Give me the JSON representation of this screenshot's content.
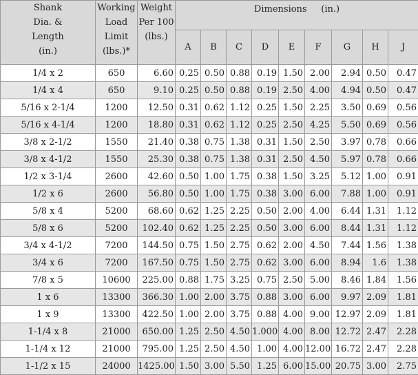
{
  "headers": {
    "shank": [
      "Shank",
      "Dia. &",
      "Length",
      "(in.)"
    ],
    "wll": [
      "Working",
      "Load",
      "Limit",
      "(lbs.)*"
    ],
    "weight": [
      "Weight",
      "Per 100",
      "(lbs.)"
    ],
    "dimensions": "Dimensions     (in.)",
    "letters": [
      "A",
      "B",
      "C",
      "D",
      "E",
      "F",
      "G",
      "H",
      "J"
    ]
  },
  "rows": [
    {
      "size": "1/4 x 2",
      "wll": "650",
      "weight": "6.60",
      "dims": [
        "0.25",
        "0.50",
        "0.88",
        "0.19",
        "1.50",
        "2.00",
        "2.94",
        "0.50",
        "0.47"
      ]
    },
    {
      "size": "1/4 x 4",
      "wll": "650",
      "weight": "9.10",
      "dims": [
        "0.25",
        "0.50",
        "0.88",
        "0.19",
        "2.50",
        "4.00",
        "4.94",
        "0.50",
        "0.47"
      ]
    },
    {
      "size": "5/16 x 2-1/4",
      "wll": "1200",
      "weight": "12.50",
      "dims": [
        "0.31",
        "0.62",
        "1.12",
        "0.25",
        "1.50",
        "2.25",
        "3.50",
        "0.69",
        "0.56"
      ]
    },
    {
      "size": "5/16 x 4-1/4",
      "wll": "1200",
      "weight": "18.80",
      "dims": [
        "0.31",
        "0.62",
        "1.12",
        "0.25",
        "2.50",
        "4.25",
        "5.50",
        "0.69",
        "0.56"
      ]
    },
    {
      "size": "3/8 x 2-1/2",
      "wll": "1550",
      "weight": "21.40",
      "dims": [
        "0.38",
        "0.75",
        "1.38",
        "0.31",
        "1.50",
        "2.50",
        "3.97",
        "0.78",
        "0.66"
      ]
    },
    {
      "size": "3/8 x 4-1/2",
      "wll": "1550",
      "weight": "25.30",
      "dims": [
        "0.38",
        "0.75",
        "1.38",
        "0.31",
        "2.50",
        "4.50",
        "5.97",
        "0.78",
        "0.66"
      ]
    },
    {
      "size": "1/2 x 3-1/4",
      "wll": "2600",
      "weight": "42.60",
      "dims": [
        "0.50",
        "1.00",
        "1.75",
        "0.38",
        "1.50",
        "3.25",
        "5.12",
        "1.00",
        "0.91"
      ]
    },
    {
      "size": "1/2 x 6",
      "wll": "2600",
      "weight": "56.80",
      "dims": [
        "0.50",
        "1.00",
        "1.75",
        "0.38",
        "3.00",
        "6.00",
        "7.88",
        "1.00",
        "0.91"
      ]
    },
    {
      "size": "5/8 x 4",
      "wll": "5200",
      "weight": "68.60",
      "dims": [
        "0.62",
        "1.25",
        "2.25",
        "0.50",
        "2.00",
        "4.00",
        "6.44",
        "1.31",
        "1.12"
      ]
    },
    {
      "size": "5/8 x 6",
      "wll": "5200",
      "weight": "102.40",
      "dims": [
        "0.62",
        "1.25",
        "2.25",
        "0.50",
        "3.00",
        "6.00",
        "8.44",
        "1.31",
        "1.12"
      ]
    },
    {
      "size": "3/4 x 4-1/2",
      "wll": "7200",
      "weight": "144.50",
      "dims": [
        "0.75",
        "1.50",
        "2.75",
        "0.62",
        "2.00",
        "4.50",
        "7.44",
        "1.56",
        "1.38"
      ]
    },
    {
      "size": "3/4 x 6",
      "wll": "7200",
      "weight": "167.50",
      "dims": [
        "0.75",
        "1.50",
        "2.75",
        "0.62",
        "3.00",
        "6.00",
        "8.94",
        "1.6",
        "1.38"
      ]
    },
    {
      "size": "7/8 x 5",
      "wll": "10600",
      "weight": "225.00",
      "dims": [
        "0.88",
        "1.75",
        "3.25",
        "0.75",
        "2.50",
        "5.00",
        "8.46",
        "1.84",
        "1.56"
      ]
    },
    {
      "size": "1 x 6",
      "wll": "13300",
      "weight": "366.30",
      "dims": [
        "1.00",
        "2.00",
        "3.75",
        "0.88",
        "3.00",
        "6.00",
        "9.97",
        "2.09",
        "1.81"
      ]
    },
    {
      "size": "1 x 9",
      "wll": "13300",
      "weight": "422.50",
      "dims": [
        "1.00",
        "2.00",
        "3.75",
        "0.88",
        "4.00",
        "9.00",
        "12.97",
        "2.09",
        "1.81"
      ]
    },
    {
      "size": "1-1/4 x 8",
      "wll": "21000",
      "weight": "650.00",
      "dims": [
        "1.25",
        "2.50",
        "4.50",
        "1.000",
        "4.00",
        "8.00",
        "12.72",
        "2.47",
        "2.28"
      ]
    },
    {
      "size": "1-1/4 x 12",
      "wll": "21000",
      "weight": "795.00",
      "dims": [
        "1.25",
        "2.50",
        "4.50",
        "1.00",
        "4.00",
        "12.00",
        "16.72",
        "2.47",
        "2.28"
      ]
    },
    {
      "size": "1-1/2 x 15",
      "wll": "24000",
      "weight": "1425.00",
      "dims": [
        "1.50",
        "3.00",
        "5.50",
        "1.25",
        "6.00",
        "15.00",
        "20.75",
        "3.00",
        "2.75"
      ]
    }
  ]
}
